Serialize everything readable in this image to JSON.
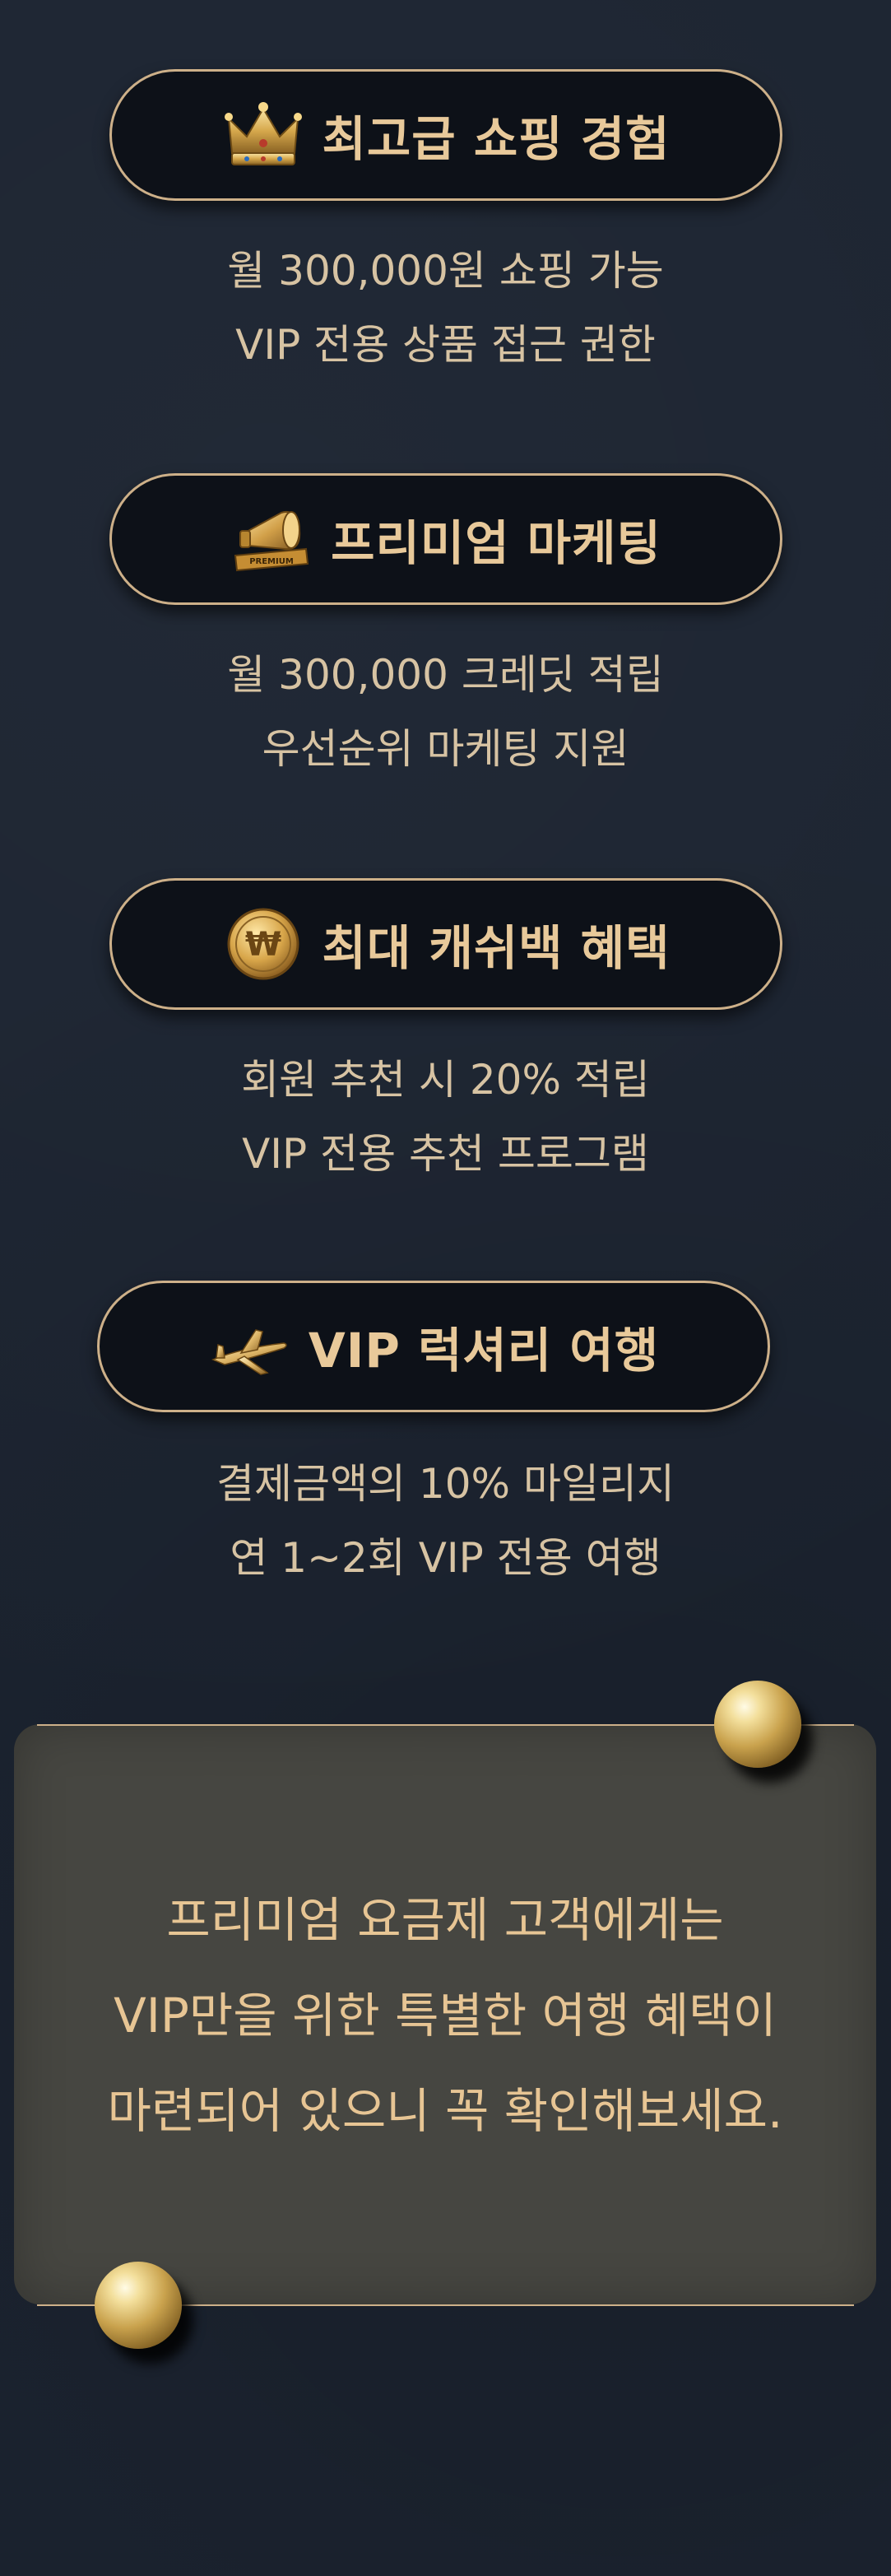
{
  "benefits": [
    {
      "title": "최고급 쇼핑 경험",
      "icon": "crown-icon",
      "lines": [
        "월 300,000원 쇼핑 가능",
        "VIP 전용 상품 접근 권한"
      ]
    },
    {
      "title": "프리미엄 마케팅",
      "icon": "premium-megaphone-icon",
      "icon_label": "PREMIUM",
      "lines": [
        "월 300,000 크레딧 적립",
        "우선순위 마케팅 지원"
      ]
    },
    {
      "title": "최대 캐쉬백 혜택",
      "icon": "gold-won-coin-icon",
      "icon_glyph": "₩",
      "lines": [
        "회원 추천 시 20% 적립",
        "VIP 전용 추천 프로그램"
      ]
    },
    {
      "title": "VIP 럭셔리 여행",
      "icon": "gold-airplane-icon",
      "lines": [
        "결제금액의 10% 마일리지",
        "연 1~2회 VIP 전용 여행"
      ]
    }
  ],
  "notice": {
    "lines": [
      "프리미엄 요금제 고객에게는",
      "VIP만을 위한 특별한 여행 혜택이",
      "마련되어 있으니 꼭 확인해보세요."
    ]
  },
  "colors": {
    "background": "#1c2431",
    "pill_border": "#cdb089",
    "pill_fill": "#0d1118",
    "title_gold": "#e8c99a",
    "desc_text": "#d7c3a3",
    "notice_card": "#464641",
    "notice_text": "#e7c594"
  }
}
